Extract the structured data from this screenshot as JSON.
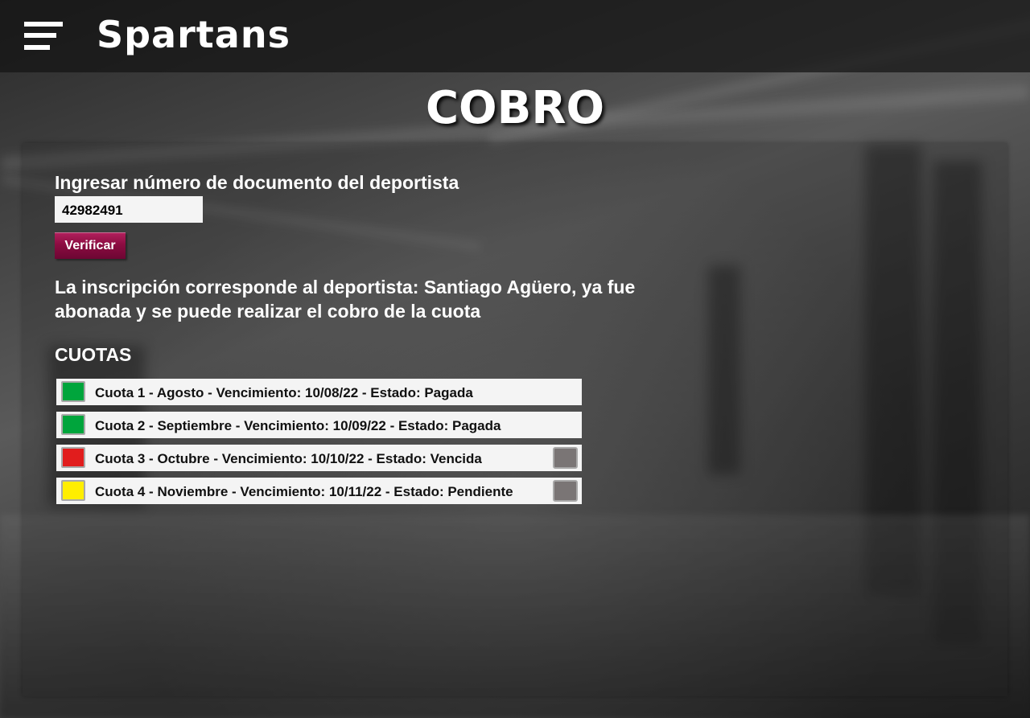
{
  "header": {
    "brand": "Spartans",
    "menu_icon": "hamburger-menu-icon"
  },
  "page": {
    "title": "COBRO"
  },
  "form": {
    "document_label": "Ingresar número de documento del deportista",
    "document_value": "42982491",
    "verify_label": "Verificar"
  },
  "result": {
    "message": "La inscripción corresponde al deportista: Santiago Agüero, ya fue abonada y se puede realizar el cobro de la cuota"
  },
  "cuotas": {
    "title": "CUOTAS",
    "items": [
      {
        "text": "Cuota 1 - Agosto - Vencimiento: 10/08/22 - Estado: Pagada",
        "status_color": "#00a53c",
        "has_checkbox": false
      },
      {
        "text": "Cuota 2 - Septiembre - Vencimiento: 10/09/22 - Estado: Pagada",
        "status_color": "#00a53c",
        "has_checkbox": false
      },
      {
        "text": "Cuota 3 - Octubre - Vencimiento: 10/10/22 - Estado: Vencida",
        "status_color": "#e11d1d",
        "has_checkbox": true
      },
      {
        "text": "Cuota 4 - Noviembre - Vencimiento: 10/11/22 - Estado: Pendiente",
        "status_color": "#ffee00",
        "has_checkbox": true
      }
    ]
  },
  "colors": {
    "button_accent": "#8c0c41",
    "paid": "#00a53c",
    "overdue": "#e11d1d",
    "pending": "#ffee00"
  }
}
